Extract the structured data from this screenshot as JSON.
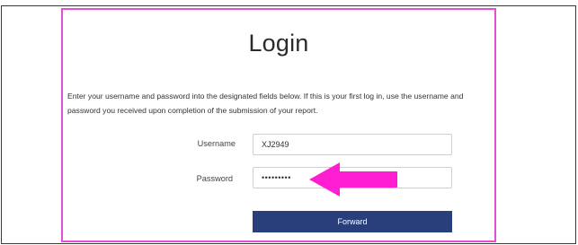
{
  "login": {
    "title": "Login",
    "instructions": "Enter your username and password into the designated fields below. If this is your first log in, use the username and password you received upon completion of the submission of your report.",
    "username_label": "Username",
    "username_value": "XJ2949",
    "password_label": "Password",
    "password_value": "wrongpass",
    "forward_label": "Forward"
  },
  "colors": {
    "panel_border": "#e44ed6",
    "annotation_arrow": "#ff1ed2",
    "button_background": "#283f7c"
  },
  "annotation": {
    "icon": "arrow-left-icon"
  }
}
